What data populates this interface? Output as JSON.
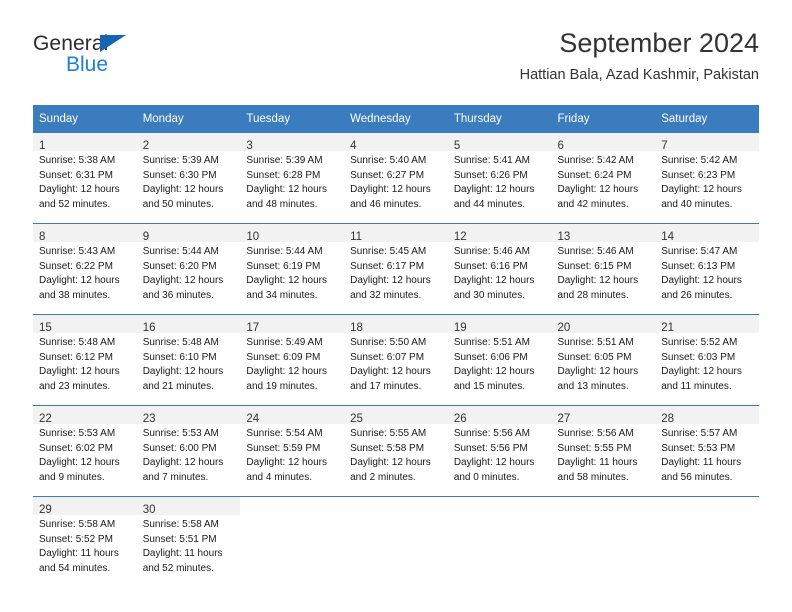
{
  "logo": {
    "word_primary": "General",
    "word_secondary": "Blue",
    "triangle_color": "#1565b0",
    "secondary_color": "#1f7fd0"
  },
  "header": {
    "title": "September 2024",
    "subtitle": "Hattian Bala, Azad Kashmir, Pakistan"
  },
  "theme": {
    "header_blue": "#3a7cbe",
    "daynum_band": "#f2f2f2",
    "text": "#1a1a1a"
  },
  "calendar": {
    "weekday_headers": [
      "Sunday",
      "Monday",
      "Tuesday",
      "Wednesday",
      "Thursday",
      "Friday",
      "Saturday"
    ],
    "weeks": [
      [
        {
          "day": "1",
          "sunrise": "Sunrise: 5:38 AM",
          "sunset": "Sunset: 6:31 PM",
          "daylight1": "Daylight: 12 hours",
          "daylight2": "and 52 minutes."
        },
        {
          "day": "2",
          "sunrise": "Sunrise: 5:39 AM",
          "sunset": "Sunset: 6:30 PM",
          "daylight1": "Daylight: 12 hours",
          "daylight2": "and 50 minutes."
        },
        {
          "day": "3",
          "sunrise": "Sunrise: 5:39 AM",
          "sunset": "Sunset: 6:28 PM",
          "daylight1": "Daylight: 12 hours",
          "daylight2": "and 48 minutes."
        },
        {
          "day": "4",
          "sunrise": "Sunrise: 5:40 AM",
          "sunset": "Sunset: 6:27 PM",
          "daylight1": "Daylight: 12 hours",
          "daylight2": "and 46 minutes."
        },
        {
          "day": "5",
          "sunrise": "Sunrise: 5:41 AM",
          "sunset": "Sunset: 6:26 PM",
          "daylight1": "Daylight: 12 hours",
          "daylight2": "and 44 minutes."
        },
        {
          "day": "6",
          "sunrise": "Sunrise: 5:42 AM",
          "sunset": "Sunset: 6:24 PM",
          "daylight1": "Daylight: 12 hours",
          "daylight2": "and 42 minutes."
        },
        {
          "day": "7",
          "sunrise": "Sunrise: 5:42 AM",
          "sunset": "Sunset: 6:23 PM",
          "daylight1": "Daylight: 12 hours",
          "daylight2": "and 40 minutes."
        }
      ],
      [
        {
          "day": "8",
          "sunrise": "Sunrise: 5:43 AM",
          "sunset": "Sunset: 6:22 PM",
          "daylight1": "Daylight: 12 hours",
          "daylight2": "and 38 minutes."
        },
        {
          "day": "9",
          "sunrise": "Sunrise: 5:44 AM",
          "sunset": "Sunset: 6:20 PM",
          "daylight1": "Daylight: 12 hours",
          "daylight2": "and 36 minutes."
        },
        {
          "day": "10",
          "sunrise": "Sunrise: 5:44 AM",
          "sunset": "Sunset: 6:19 PM",
          "daylight1": "Daylight: 12 hours",
          "daylight2": "and 34 minutes."
        },
        {
          "day": "11",
          "sunrise": "Sunrise: 5:45 AM",
          "sunset": "Sunset: 6:17 PM",
          "daylight1": "Daylight: 12 hours",
          "daylight2": "and 32 minutes."
        },
        {
          "day": "12",
          "sunrise": "Sunrise: 5:46 AM",
          "sunset": "Sunset: 6:16 PM",
          "daylight1": "Daylight: 12 hours",
          "daylight2": "and 30 minutes."
        },
        {
          "day": "13",
          "sunrise": "Sunrise: 5:46 AM",
          "sunset": "Sunset: 6:15 PM",
          "daylight1": "Daylight: 12 hours",
          "daylight2": "and 28 minutes."
        },
        {
          "day": "14",
          "sunrise": "Sunrise: 5:47 AM",
          "sunset": "Sunset: 6:13 PM",
          "daylight1": "Daylight: 12 hours",
          "daylight2": "and 26 minutes."
        }
      ],
      [
        {
          "day": "15",
          "sunrise": "Sunrise: 5:48 AM",
          "sunset": "Sunset: 6:12 PM",
          "daylight1": "Daylight: 12 hours",
          "daylight2": "and 23 minutes."
        },
        {
          "day": "16",
          "sunrise": "Sunrise: 5:48 AM",
          "sunset": "Sunset: 6:10 PM",
          "daylight1": "Daylight: 12 hours",
          "daylight2": "and 21 minutes."
        },
        {
          "day": "17",
          "sunrise": "Sunrise: 5:49 AM",
          "sunset": "Sunset: 6:09 PM",
          "daylight1": "Daylight: 12 hours",
          "daylight2": "and 19 minutes."
        },
        {
          "day": "18",
          "sunrise": "Sunrise: 5:50 AM",
          "sunset": "Sunset: 6:07 PM",
          "daylight1": "Daylight: 12 hours",
          "daylight2": "and 17 minutes."
        },
        {
          "day": "19",
          "sunrise": "Sunrise: 5:51 AM",
          "sunset": "Sunset: 6:06 PM",
          "daylight1": "Daylight: 12 hours",
          "daylight2": "and 15 minutes."
        },
        {
          "day": "20",
          "sunrise": "Sunrise: 5:51 AM",
          "sunset": "Sunset: 6:05 PM",
          "daylight1": "Daylight: 12 hours",
          "daylight2": "and 13 minutes."
        },
        {
          "day": "21",
          "sunrise": "Sunrise: 5:52 AM",
          "sunset": "Sunset: 6:03 PM",
          "daylight1": "Daylight: 12 hours",
          "daylight2": "and 11 minutes."
        }
      ],
      [
        {
          "day": "22",
          "sunrise": "Sunrise: 5:53 AM",
          "sunset": "Sunset: 6:02 PM",
          "daylight1": "Daylight: 12 hours",
          "daylight2": "and 9 minutes."
        },
        {
          "day": "23",
          "sunrise": "Sunrise: 5:53 AM",
          "sunset": "Sunset: 6:00 PM",
          "daylight1": "Daylight: 12 hours",
          "daylight2": "and 7 minutes."
        },
        {
          "day": "24",
          "sunrise": "Sunrise: 5:54 AM",
          "sunset": "Sunset: 5:59 PM",
          "daylight1": "Daylight: 12 hours",
          "daylight2": "and 4 minutes."
        },
        {
          "day": "25",
          "sunrise": "Sunrise: 5:55 AM",
          "sunset": "Sunset: 5:58 PM",
          "daylight1": "Daylight: 12 hours",
          "daylight2": "and 2 minutes."
        },
        {
          "day": "26",
          "sunrise": "Sunrise: 5:56 AM",
          "sunset": "Sunset: 5:56 PM",
          "daylight1": "Daylight: 12 hours",
          "daylight2": "and 0 minutes."
        },
        {
          "day": "27",
          "sunrise": "Sunrise: 5:56 AM",
          "sunset": "Sunset: 5:55 PM",
          "daylight1": "Daylight: 11 hours",
          "daylight2": "and 58 minutes."
        },
        {
          "day": "28",
          "sunrise": "Sunrise: 5:57 AM",
          "sunset": "Sunset: 5:53 PM",
          "daylight1": "Daylight: 11 hours",
          "daylight2": "and 56 minutes."
        }
      ],
      [
        {
          "day": "29",
          "sunrise": "Sunrise: 5:58 AM",
          "sunset": "Sunset: 5:52 PM",
          "daylight1": "Daylight: 11 hours",
          "daylight2": "and 54 minutes."
        },
        {
          "day": "30",
          "sunrise": "Sunrise: 5:58 AM",
          "sunset": "Sunset: 5:51 PM",
          "daylight1": "Daylight: 11 hours",
          "daylight2": "and 52 minutes."
        },
        {
          "day": "",
          "sunrise": "",
          "sunset": "",
          "daylight1": "",
          "daylight2": ""
        },
        {
          "day": "",
          "sunrise": "",
          "sunset": "",
          "daylight1": "",
          "daylight2": ""
        },
        {
          "day": "",
          "sunrise": "",
          "sunset": "",
          "daylight1": "",
          "daylight2": ""
        },
        {
          "day": "",
          "sunrise": "",
          "sunset": "",
          "daylight1": "",
          "daylight2": ""
        },
        {
          "day": "",
          "sunrise": "",
          "sunset": "",
          "daylight1": "",
          "daylight2": ""
        }
      ]
    ]
  }
}
